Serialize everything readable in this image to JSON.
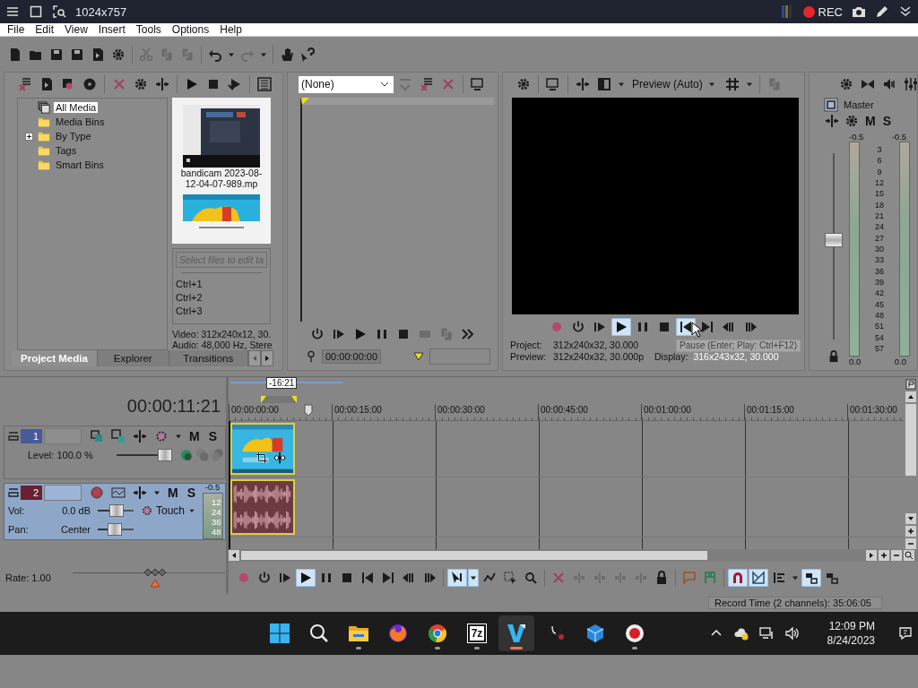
{
  "capture_bar": {
    "title": "1024x757",
    "rec_label": "REC",
    "recording": true
  },
  "menu": [
    "File",
    "Edit",
    "View",
    "Insert",
    "Tools",
    "Options",
    "Help"
  ],
  "project_media": {
    "tree": [
      {
        "label": "All Media",
        "selected": true
      },
      {
        "label": "Media Bins",
        "selected": false
      },
      {
        "label": "By Type",
        "selected": false,
        "expanded": false
      },
      {
        "label": "Tags",
        "selected": false
      },
      {
        "label": "Smart Bins",
        "selected": false
      }
    ],
    "media": [
      {
        "kind": "picture",
        "caption": [
          "bandicam 2023-08-",
          "12-04-07-989.mp"
        ]
      },
      {
        "kind": "picture"
      }
    ],
    "tag_field": {
      "placeholder": "Select files to edit ta"
    },
    "shortcuts": [
      "Ctrl+1",
      "Ctrl+2",
      "Ctrl+3"
    ],
    "info": [
      "Video: 312x240x12, 30.",
      "Audio: 48,000 Hz, Stere"
    ],
    "tabs": [
      {
        "label": "Project Media",
        "selected": true
      },
      {
        "label": "Explorer",
        "selected": false
      },
      {
        "label": "Transitions",
        "selected": false
      }
    ]
  },
  "trimmer": {
    "preset": "(None)",
    "timecode": "00:00:00:00"
  },
  "preview": {
    "quality": "Preview (Auto)",
    "transport": [
      {
        "kind": "record",
        "on": false
      },
      {
        "kind": "power",
        "on": false
      },
      {
        "kind": "play-from",
        "on": false
      },
      {
        "kind": "play",
        "on": true
      },
      {
        "kind": "pause",
        "on": false
      },
      {
        "kind": "stop",
        "on": false
      },
      {
        "kind": "skip-start",
        "on": true
      },
      {
        "kind": "skip-end",
        "on": false
      },
      {
        "kind": "frame-back",
        "on": false
      },
      {
        "kind": "frame-forward",
        "on": false
      }
    ],
    "tooltip": "Pause (Enter; Play: Ctrl+F12)",
    "info": [
      {
        "label": "Project:",
        "value": "312x240x32, 30.000"
      },
      {
        "label": "Preview:",
        "value": "312x240x32, 30.000p"
      },
      {
        "label": "Display:",
        "value": "316x243x32, 30.000"
      }
    ]
  },
  "master": {
    "title": "Master",
    "mute": "M",
    "solo": "S",
    "peaks": [
      "-0.5",
      "-0.5"
    ],
    "scale": [
      "3",
      "6",
      "9",
      "12",
      "15",
      "18",
      "21",
      "24",
      "27",
      "30",
      "33",
      "36",
      "39",
      "42",
      "45",
      "48",
      "51",
      "54",
      "57"
    ],
    "readings": [
      "0.0",
      "0.0"
    ],
    "fader": {
      "level": 0.55
    }
  },
  "timeline": {
    "time": "00:00:11:21",
    "loop_length": "-16:21",
    "ruler": [
      "00:00:00:00",
      "00:00:15:00",
      "00:00:30:00",
      "00:00:45:00",
      "00:01:00:00",
      "00:01:15:00",
      "00:01:30:00"
    ],
    "tracks": [
      {
        "kind": "video",
        "number": "1",
        "selected": false,
        "mute": "M",
        "solo": "S",
        "fader": {
          "reading": "Level: 100.0 %",
          "level": 1
        }
      },
      {
        "kind": "audio",
        "number": "2",
        "selected": true,
        "mute": "M",
        "solo": "S",
        "vol_label": "Vol:",
        "vol": {
          "reading": "0.0 dB",
          "level": 0.55
        },
        "automation": "Touch",
        "pan_label": "Pan:",
        "pan": {
          "reading": "Center",
          "level": 0.45
        },
        "peak": "-0.5",
        "meter_scale": [
          "12",
          "24",
          "36",
          "48"
        ]
      }
    ],
    "rate": {
      "label": "Rate: 1.00",
      "level": 0.55
    },
    "toolbar": [
      {
        "kind": "record",
        "on": false
      },
      {
        "kind": "power",
        "on": false
      },
      {
        "kind": "play-from",
        "on": false
      },
      {
        "kind": "play",
        "on": true
      },
      {
        "kind": "pause",
        "on": false
      },
      {
        "kind": "stop",
        "on": false
      },
      {
        "kind": "skip-start",
        "on": false
      },
      {
        "kind": "skip-end",
        "on": false
      },
      {
        "kind": "frame-back",
        "on": false
      },
      {
        "kind": "frame-forward",
        "on": false
      },
      {
        "kind": "pointer",
        "on": true
      },
      {
        "kind": "envelope",
        "on": false
      },
      {
        "kind": "selection",
        "on": false
      },
      {
        "kind": "zoom",
        "on": false
      },
      {
        "kind": "cross",
        "on": false
      },
      {
        "kind": "trim",
        "on": false
      },
      {
        "kind": "trim",
        "on": false
      },
      {
        "kind": "trim",
        "on": false
      },
      {
        "kind": "trim",
        "on": false
      },
      {
        "kind": "lock",
        "on": false
      },
      {
        "kind": "marker",
        "on": false
      },
      {
        "kind": "region",
        "on": false
      },
      {
        "kind": "magnet",
        "on": true
      },
      {
        "kind": "crossfade",
        "on": true
      },
      {
        "kind": "ripple",
        "on": false
      },
      {
        "kind": "link",
        "on": true
      },
      {
        "kind": "link",
        "on": false
      }
    ]
  },
  "status": "Record Time (2 channels): 35:06:05",
  "taskbar": {
    "apps": [
      {
        "kind": "start",
        "running": false,
        "active": false
      },
      {
        "kind": "search",
        "running": false,
        "active": false
      },
      {
        "kind": "folder",
        "running": true,
        "active": false
      },
      {
        "kind": "fox",
        "running": false,
        "active": false
      },
      {
        "kind": "chrome",
        "running": true,
        "active": false
      },
      {
        "kind": "archive",
        "label": "7z",
        "running": true,
        "active": false
      },
      {
        "kind": "editor",
        "running": true,
        "active": true
      },
      {
        "kind": "stethoscope",
        "running": false,
        "active": false
      },
      {
        "kind": "cubes",
        "running": false,
        "active": false
      },
      {
        "kind": "record",
        "running": true,
        "active": false
      }
    ],
    "clock": {
      "time": "12:09 PM",
      "date": "8/24/2023"
    }
  }
}
